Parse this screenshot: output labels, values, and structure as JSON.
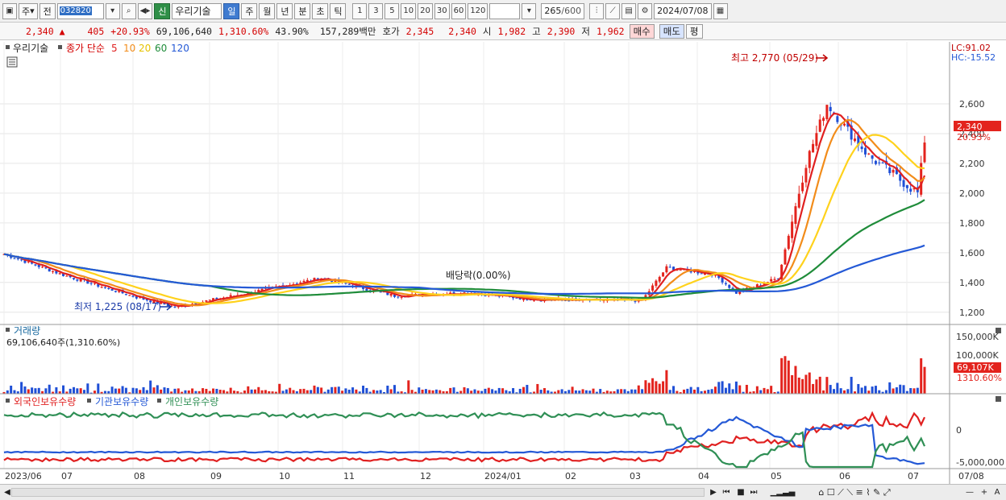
{
  "toolbar": {
    "period_select": "주",
    "prev_label": "전",
    "code": "032820",
    "market_badge": "신",
    "stock_name": "우리기술",
    "tabs": [
      "일",
      "주",
      "월",
      "년",
      "분",
      "초",
      "틱"
    ],
    "active_tab": "일",
    "intervals": [
      "1",
      "3",
      "5",
      "10",
      "20",
      "30",
      "60",
      "120"
    ],
    "count": "265",
    "count_total": "/600",
    "date": "2024/07/08"
  },
  "quote": {
    "price": "2,340",
    "change": "405",
    "change_pct": "+20.93%",
    "volume": "69,106,640",
    "volume_ratio": "1,310.60%",
    "turnover": "43.90%",
    "amount": "157,289",
    "amount_unit": "백만",
    "hoga_label": "호가",
    "ask": "2,345",
    "bid": "2,340",
    "open_label": "시",
    "open": "1,982",
    "high_label": "고",
    "high": "2,390",
    "low_label": "저",
    "low": "1,962",
    "buy_label": "매수",
    "sell_label": "매도",
    "avg_label": "평"
  },
  "colors": {
    "up": "#e3231d",
    "down": "#1f4fd6",
    "ma5": "#e02020",
    "ma10": "#f28c1a",
    "ma20": "#ffd21c",
    "ma60": "#1f8c3a",
    "ma120": "#2459d6",
    "foreign": "#e02020",
    "institution": "#2459d6",
    "individual": "#2f8f55"
  },
  "chart_data": [
    {
      "type": "candlestick",
      "title": "우리기술",
      "legend": {
        "indicator": "종가 단순",
        "items": [
          "5",
          "10",
          "20",
          "60",
          "120"
        ]
      },
      "lc_label": "LC:91.02",
      "hc_label": "HC:-15.52",
      "ylim": [
        1150,
        2800
      ],
      "y_ticks": [
        1200,
        1400,
        1600,
        1800,
        2000,
        2200,
        2400,
        2600
      ],
      "y_tick_labels": [
        "1,200",
        "1,400",
        "1,600",
        "1,800",
        "2,000",
        "2,200",
        "2,400",
        "2,600"
      ],
      "last_price_label": "2,340",
      "last_change_label": "20.93%",
      "last_price": 2340,
      "annotations": {
        "high": "최고 2,770 (05/29)",
        "low": "최저 1,225 (08/17)",
        "dividend": "배당락(0.00%)"
      },
      "x_labels": [
        "2023/06",
        "07",
        "08",
        "09",
        "10",
        "11",
        "12",
        "2024/01",
        "02",
        "03",
        "04",
        "05",
        "06",
        "07",
        "07/08"
      ],
      "anchors": [
        {
          "label": "2023/06",
          "close": 1590
        },
        {
          "label": "07",
          "close": 1450
        },
        {
          "label": "08",
          "close": 1300
        },
        {
          "label": "08/17",
          "close": 1235
        },
        {
          "label": "09",
          "close": 1330
        },
        {
          "label": "10",
          "close": 1430
        },
        {
          "label": "11",
          "close": 1310
        },
        {
          "label": "12",
          "close": 1330
        },
        {
          "label": "2024/01",
          "close": 1290
        },
        {
          "label": "02",
          "close": 1280
        },
        {
          "label": "03",
          "close": 1280
        },
        {
          "label": "03-mid",
          "close": 1500
        },
        {
          "label": "04",
          "close": 1450
        },
        {
          "label": "04-mid",
          "close": 1330
        },
        {
          "label": "05",
          "close": 1430
        },
        {
          "label": "05-mid",
          "close": 2200
        },
        {
          "label": "05/29",
          "close": 2600
        },
        {
          "label": "06",
          "close": 2450
        },
        {
          "label": "06-mid",
          "close": 2250
        },
        {
          "label": "07",
          "close": 2000
        },
        {
          "label": "07/08",
          "close": 2340
        }
      ]
    },
    {
      "type": "bar",
      "title": "거래량",
      "subtitle": "69,106,640주(1,310.60%)",
      "y_tick_labels": [
        "150,000K",
        "100,000K"
      ],
      "last_volume_label": "69,107K",
      "last_ratio_label": "1310.60%",
      "ylim": [
        0,
        170000
      ],
      "last_volume": 69107
    },
    {
      "type": "line",
      "series": [
        {
          "name": "외국인보유수량"
        },
        {
          "name": "기관보유수량"
        },
        {
          "name": "개인보유수량"
        }
      ],
      "y_tick_labels": [
        "0",
        "-5,000,000"
      ],
      "ylim": [
        -5500000,
        3500000
      ]
    }
  ]
}
